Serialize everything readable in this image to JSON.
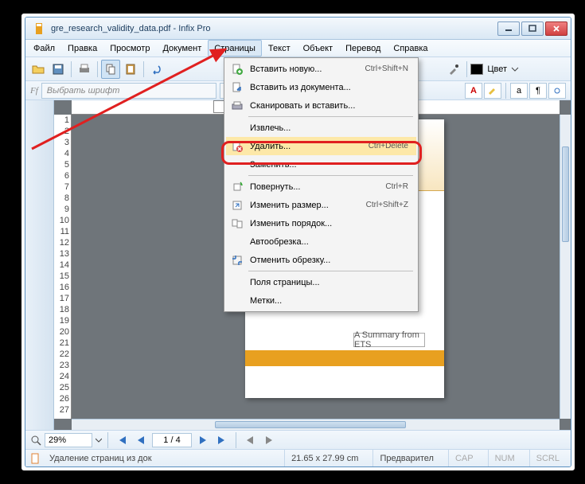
{
  "title": "gre_research_validity_data.pdf - Infix Pro",
  "menus": [
    "Файл",
    "Правка",
    "Просмотр",
    "Документ",
    "Страницы",
    "Текст",
    "Объект",
    "Перевод",
    "Справка"
  ],
  "active_menu_index": 4,
  "font_placeholder": "Выбрать шрифт",
  "color_label": "Цвет",
  "ruler_page": "1",
  "ets_label": "ETS",
  "summary_label": "A Summary from ETS",
  "zoom": "29%",
  "page_nav": "1 / 4",
  "status_text": "Удаление страниц из док",
  "page_dims": "21.65 x 27.99 cm",
  "preview_label": "Предварител",
  "caps": "CAP",
  "num": "NUM",
  "scrl": "SCRL",
  "ruler_v": [
    "1",
    "2",
    "3",
    "4",
    "5",
    "6",
    "7",
    "8",
    "9",
    "10",
    "11",
    "12",
    "13",
    "14",
    "15",
    "16",
    "17",
    "18",
    "19",
    "20",
    "21",
    "22",
    "23",
    "24",
    "25",
    "26",
    "27"
  ],
  "dropdown": [
    {
      "label": "Вставить новую...",
      "short": "Ctrl+Shift+N",
      "icon": "page-add"
    },
    {
      "label": "Вставить из документа...",
      "short": "",
      "icon": "page-import"
    },
    {
      "label": "Сканировать и вставить...",
      "short": "",
      "icon": "scanner"
    },
    {
      "sep": true
    },
    {
      "label": "Извлечь...",
      "short": "",
      "icon": ""
    },
    {
      "label": "Удалить...",
      "short": "Ctrl+Delete",
      "icon": "page-delete",
      "hover": true
    },
    {
      "label": "Заменить...",
      "short": "",
      "icon": ""
    },
    {
      "sep": true
    },
    {
      "label": "Повернуть...",
      "short": "Ctrl+R",
      "icon": "rotate"
    },
    {
      "label": "Изменить размер...",
      "short": "Ctrl+Shift+Z",
      "icon": "resize"
    },
    {
      "label": "Изменить порядок...",
      "short": "",
      "icon": "reorder"
    },
    {
      "label": "Автообрезка...",
      "short": "",
      "icon": ""
    },
    {
      "label": "Отменить обрезку...",
      "short": "",
      "icon": "uncrop"
    },
    {
      "sep": true
    },
    {
      "label": "Поля страницы...",
      "short": "",
      "icon": ""
    },
    {
      "label": "Метки...",
      "short": "",
      "icon": ""
    }
  ]
}
